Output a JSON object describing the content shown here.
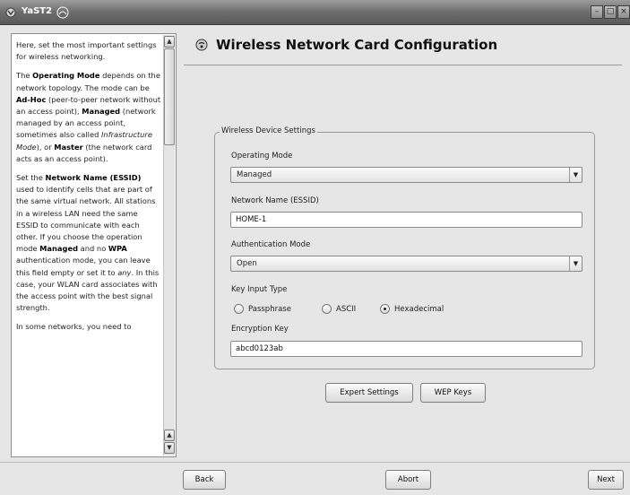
{
  "window": {
    "title": "YaST2",
    "controls": [
      "minimize-icon",
      "maximize-icon",
      "close-icon"
    ]
  },
  "help": {
    "paragraphs": [
      [
        {
          "t": "Here, set the most important settings for wireless networking."
        }
      ],
      [
        {
          "t": "The "
        },
        {
          "t": "Operating Mode",
          "b": true
        },
        {
          "t": " depends on the network topology. The mode can be "
        },
        {
          "t": "Ad-Hoc",
          "b": true
        },
        {
          "t": " (peer-to-peer network without an access point), "
        },
        {
          "t": "Managed",
          "b": true
        },
        {
          "t": " (network managed by an access point, sometimes also called "
        },
        {
          "t": "Infrastructure Mode",
          "i": true
        },
        {
          "t": "), or "
        },
        {
          "t": "Master",
          "b": true
        },
        {
          "t": " (the network card acts as an access point)."
        }
      ],
      [
        {
          "t": "Set the "
        },
        {
          "t": "Network Name (ESSID)",
          "b": true
        },
        {
          "t": " used to identify cells that are part of the same virtual network. All stations in a wireless LAN need the same ESSID to communicate with each other. If you choose the operation mode "
        },
        {
          "t": "Managed",
          "b": true
        },
        {
          "t": " and no "
        },
        {
          "t": "WPA",
          "b": true
        },
        {
          "t": " authentication mode, you can leave this field empty or set it to "
        },
        {
          "t": "any",
          "i": true
        },
        {
          "t": ". In this case, your WLAN card associates with the access point with the best signal strength."
        }
      ],
      [
        {
          "t": "In some networks, you need to"
        }
      ]
    ]
  },
  "main": {
    "title": "Wireless Network Card Configuration",
    "group_title": "Wireless Device Settings",
    "operating_mode_label": "Operating Mode",
    "operating_mode_value": "Managed",
    "essid_label": "Network Name (ESSID)",
    "essid_value": "HOME-1",
    "auth_mode_label": "Authentication Mode",
    "auth_mode_value": "Open",
    "key_input_label": "Key Input Type",
    "key_types": [
      {
        "label": "Passphrase",
        "selected": false
      },
      {
        "label": "ASCII",
        "selected": false
      },
      {
        "label": "Hexadecimal",
        "selected": true
      }
    ],
    "encryption_label": "Encryption Key",
    "encryption_value": "abcd0123ab",
    "expert_button": "Expert Settings",
    "wep_button": "WEP Keys"
  },
  "footer": {
    "back": "Back",
    "abort": "Abort",
    "next": "Next"
  }
}
